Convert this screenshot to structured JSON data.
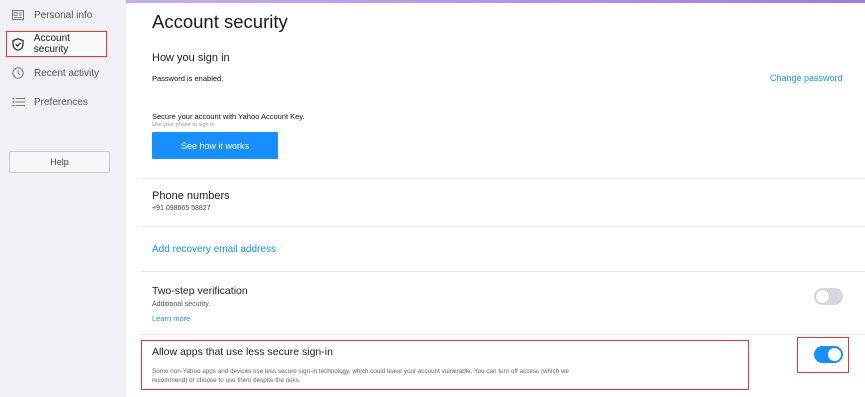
{
  "sidebar": {
    "items": [
      {
        "label": "Personal info",
        "icon": "id-card-icon"
      },
      {
        "label": "Account security",
        "icon": "shield-icon"
      },
      {
        "label": "Recent activity",
        "icon": "clock-icon"
      },
      {
        "label": "Preferences",
        "icon": "list-icon"
      }
    ],
    "help_label": "Help"
  },
  "page": {
    "title": "Account security"
  },
  "signin": {
    "title": "How you sign in",
    "password_status": "Password is enabled.",
    "change_password": "Change password",
    "account_key_title": "Secure your account with Yahoo Account Key.",
    "account_key_sub": "Use your phone to sign in",
    "account_key_button": "See how it works"
  },
  "phone": {
    "title": "Phone numbers",
    "number": "+91 098665 58827"
  },
  "recovery": {
    "link": "Add recovery email address"
  },
  "two_step": {
    "title": "Two-step verification",
    "sub": "Additional security.",
    "learn_more": "Learn more",
    "enabled": false
  },
  "less_secure": {
    "title": "Allow apps that use less secure sign-in",
    "desc_line1": "Some non-Yahoo apps and devices use less secure sign-in technology, which could leave your account vulnerable. You can turn off access (which we",
    "desc_line2": "recommend) or choose to use them despite the risks.",
    "enabled": true
  },
  "colors": {
    "accent": "#188fff",
    "highlight": "#e0353b",
    "sidebar_bg": "#f1f1f5"
  }
}
